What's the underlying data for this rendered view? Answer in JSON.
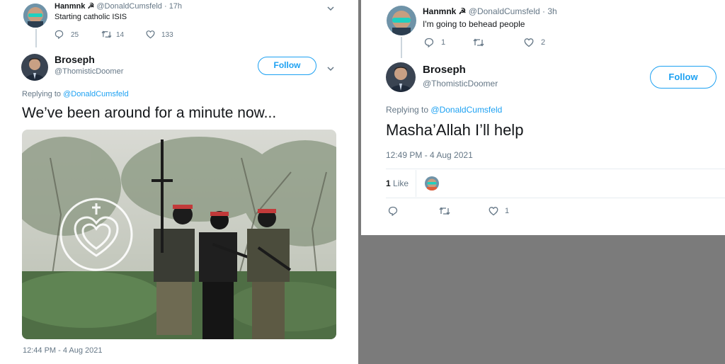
{
  "left": {
    "parent_tweet": {
      "display_name": "Hanmnk ☭",
      "handle": "@DonaldCumsfeld",
      "dot": "·",
      "time": "17h",
      "text": "Starting catholic ISIS",
      "replies": "25",
      "retweets": "14",
      "likes": "133"
    },
    "reply_tweet": {
      "display_name": "Broseph",
      "handle": "@ThomisticDoomer",
      "follow_label": "Follow",
      "replying_label": "Replying to",
      "replying_handle": "@DonaldCumsfeld",
      "text": "We’ve been around for a minute now...",
      "timestamp": "12:44 PM - 4 Aug 2021"
    }
  },
  "right": {
    "parent_tweet": {
      "display_name": "Hanmnk ☭",
      "handle": "@DonaldCumsfeld",
      "dot": "·",
      "time": "3h",
      "text": "I'm going to behead people",
      "replies": "1",
      "likes": "2"
    },
    "reply_tweet": {
      "display_name": "Broseph",
      "handle": "@ThomisticDoomer",
      "follow_label": "Follow",
      "replying_label": "Replying to",
      "replying_handle": "@DonaldCumsfeld",
      "text": "Masha’Allah I’ll help",
      "timestamp": "12:49 PM - 4 Aug 2021",
      "likes_count": "1",
      "likes_word": "Like",
      "action_likes": "1"
    }
  },
  "colors": {
    "accent": "#1da1f2",
    "muted": "#657786",
    "text": "#14171a",
    "background": "#7b7b7b"
  }
}
